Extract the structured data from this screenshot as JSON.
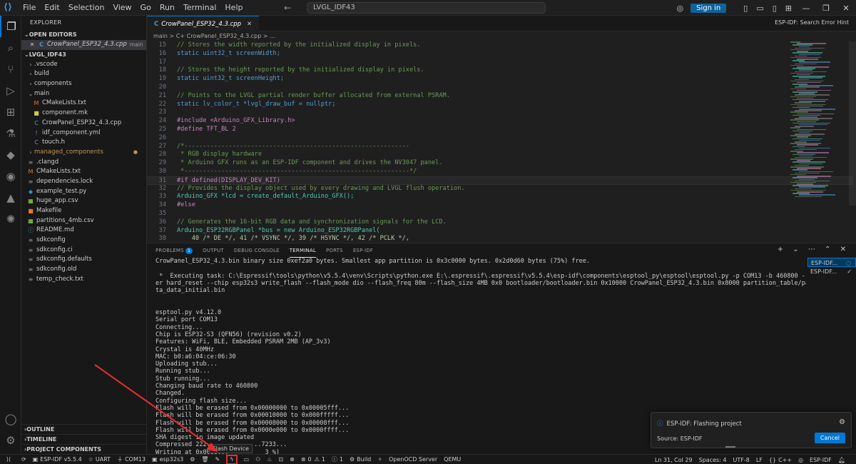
{
  "titlebar": {
    "menu": [
      "File",
      "Edit",
      "Selection",
      "View",
      "Go",
      "Run",
      "Terminal",
      "Help"
    ],
    "search_text": "LVGL_IDF43",
    "signin_label": "Sign in"
  },
  "sidebar": {
    "title": "EXPLORER",
    "open_editors_label": "OPEN EDITORS",
    "open_editor": {
      "name": "CrowPanel_ESP32_4.3.cpp",
      "folder": "main"
    },
    "project_label": "LVGL_IDF43",
    "tree": [
      {
        "name": ".vscode",
        "type": "folder",
        "depth": 1,
        "open": false
      },
      {
        "name": "build",
        "type": "folder",
        "depth": 1,
        "open": false
      },
      {
        "name": "components",
        "type": "folder",
        "depth": 1,
        "open": false
      },
      {
        "name": "main",
        "type": "folder",
        "depth": 1,
        "open": true
      },
      {
        "name": "CMakeLists.txt",
        "type": "cmake",
        "depth": 2
      },
      {
        "name": "component.mk",
        "type": "mk",
        "depth": 2
      },
      {
        "name": "CrowPanel_ESP32_4.3.cpp",
        "type": "cpp",
        "depth": 2
      },
      {
        "name": "idf_component.yml",
        "type": "yml",
        "depth": 2
      },
      {
        "name": "touch.h",
        "type": "h",
        "depth": 2
      },
      {
        "name": "managed_components",
        "type": "folder-mod",
        "depth": 1,
        "open": false
      },
      {
        "name": ".clangd",
        "type": "file",
        "depth": 1
      },
      {
        "name": "CMakeLists.txt",
        "type": "cmake",
        "depth": 1
      },
      {
        "name": "dependencies.lock",
        "type": "file",
        "depth": 1
      },
      {
        "name": "example_test.py",
        "type": "py",
        "depth": 1
      },
      {
        "name": "huge_app.csv",
        "type": "csv",
        "depth": 1
      },
      {
        "name": "Makefile",
        "type": "make",
        "depth": 1
      },
      {
        "name": "partitions_4mb.csv",
        "type": "csv",
        "depth": 1
      },
      {
        "name": "README.md",
        "type": "md",
        "depth": 1
      },
      {
        "name": "sdkconfig",
        "type": "file",
        "depth": 1
      },
      {
        "name": "sdkconfig.ci",
        "type": "file",
        "depth": 1
      },
      {
        "name": "sdkconfig.defaults",
        "type": "file",
        "depth": 1
      },
      {
        "name": "sdkconfig.old",
        "type": "file",
        "depth": 1
      },
      {
        "name": "temp_check.txt",
        "type": "file",
        "depth": 1
      }
    ],
    "bottom_sections": [
      "OUTLINE",
      "TIMELINE",
      "PROJECT COMPONENTS"
    ]
  },
  "editor": {
    "tab_label": "CrowPanel_ESP32_4.3.cpp",
    "hint": "ESP-IDF: Search Error Hint",
    "breadcrumb": "main > C+ CrowPanel_ESP32_4.3.cpp > ...",
    "lines": [
      {
        "n": "15",
        "t": "// Stores the width reported by the initialized display in pixels."
      },
      {
        "n": "16",
        "t": "static uint32_t screenWidth;"
      },
      {
        "n": "17",
        "t": ""
      },
      {
        "n": "18",
        "t": "// Stores the height reported by the initialized display in pixels."
      },
      {
        "n": "19",
        "t": "static uint32_t screenHeight;"
      },
      {
        "n": "20",
        "t": ""
      },
      {
        "n": "21",
        "t": "// Points to the LVGL partial render buffer allocated from external PSRAM."
      },
      {
        "n": "22",
        "t": "static lv_color_t *lvgl_draw_buf = nullptr;"
      },
      {
        "n": "23",
        "t": ""
      },
      {
        "n": "24",
        "t": "#include <Arduino_GFX_Library.h>"
      },
      {
        "n": "25",
        "t": "#define TFT_BL 2"
      },
      {
        "n": "26",
        "t": ""
      },
      {
        "n": "27",
        "t": "/*-------------------------------------------------------------"
      },
      {
        "n": "28",
        "t": " * RGB display hardware"
      },
      {
        "n": "29",
        "t": " * Arduino GFX runs as an ESP-IDF component and drives the NV3047 panel."
      },
      {
        "n": "30",
        "t": " *-------------------------------------------------------------*/"
      },
      {
        "n": "31",
        "t": "#if defined(DISPLAY_DEV_KIT)"
      },
      {
        "n": "32",
        "t": "// Provides the display object used by every drawing and LVGL flush operation."
      },
      {
        "n": "33",
        "t": "Arduino_GFX *lcd = create_default_Arduino_GFX();"
      },
      {
        "n": "34",
        "t": "#else"
      },
      {
        "n": "35",
        "t": ""
      },
      {
        "n": "36",
        "t": "// Generates the 16-bit RGB data and synchronization signals for the LCD."
      },
      {
        "n": "37",
        "t": "Arduino_ESP32RGBPanel *bus = new Arduino_ESP32RGBPanel("
      },
      {
        "n": "38",
        "t": "    40 /* DE */, 41 /* VSYNC */, 39 /* HSYNC */, 42 /* PCLK */,"
      }
    ]
  },
  "panel": {
    "tabs": [
      "PROBLEMS",
      "OUTPUT",
      "DEBUG CONSOLE",
      "TERMINAL",
      "PORTS",
      "ESP-IDF"
    ],
    "problems_count": "1",
    "active_tab": "TERMINAL",
    "terminal_lines": [
      "CrowPanel_ESP32_4.3.bin binary size 0xef2a0 bytes. Smallest app partition is 0x3c0000 bytes. 0x2d0d60 bytes (75%) free.",
      "",
      " *  Executing task: C:\\Espressif\\tools\\python\\v5.5.4\\venv\\Scripts\\python.exe E:\\.espressif\\.espressif\\v5.5.4\\esp-idf\\components\\esptool_py\\esptool\\esptool.py -p COM13 -b 460800 --before default_reset --aft",
      "er hard_reset --chip esp32s3 write_flash --flash_mode dio --flash_freq 80m --flash_size 4MB 0x0 bootloader/bootloader.bin 0x10000 CrowPanel_ESP32_4.3.bin 0x8000 partition_table/partition-table.bin 0xe000 o",
      "ta_data_initial.bin",
      "",
      "",
      "esptool.py v4.12.0",
      "Serial port COM13",
      "Connecting...",
      "Chip is ESP32-S3 (QFN56) (revision v0.2)",
      "Features: WiFi, BLE, Embedded PSRAM 2MB (AP_3v3)",
      "Crystal is 40MHz",
      "MAC: b0:a6:04:ce:06:30",
      "Uploading stub...",
      "Running stub...",
      "Stub running...",
      "Changing baud rate to 460800",
      "Changed.",
      "Configuring flash size...",
      "Flash will be erased from 0x00000000 to 0x00005fff...",
      "Flash will be erased from 0x00010000 to 0x000fffff...",
      "Flash will be erased from 0x00008000 to 0x00008fff...",
      "Flash will be erased from 0x0000e000 to 0x0000ffff...",
      "SHA digest in image updated",
      "Compressed 222...         ...7233...",
      "Writing at 0x0000...          3 %)"
    ],
    "terminal_instances": [
      "ESP-IDF...",
      "ESP-IDF..."
    ]
  },
  "notification": {
    "message": "ESP-IDF: Flashing project",
    "source": "Source: ESP-IDF",
    "button": "Cancel"
  },
  "tooltip": "Flash Device",
  "statusbar": {
    "idf_version": "ESP-IDF v5.5.4",
    "uart": "UART",
    "port": "COM13",
    "target": "esp32s3",
    "errors": "0",
    "warnings": "1",
    "info": "1",
    "build": "Build",
    "openocd": "OpenOCD Server",
    "qemu": "QEMU",
    "position": "Ln 31, Col 29",
    "spaces": "Spaces: 4",
    "encoding": "UTF-8",
    "eol": "LF",
    "language": "C++",
    "idf": "ESP-IDF"
  },
  "colors": {
    "accent": "#0078d4",
    "highlight_box": "#e52d2d",
    "keyword": "#569cd6",
    "type": "#4ec9b0",
    "comment": "#6a9955",
    "preproc": "#c586c0",
    "string": "#ce9178",
    "number": "#b5cea8"
  }
}
